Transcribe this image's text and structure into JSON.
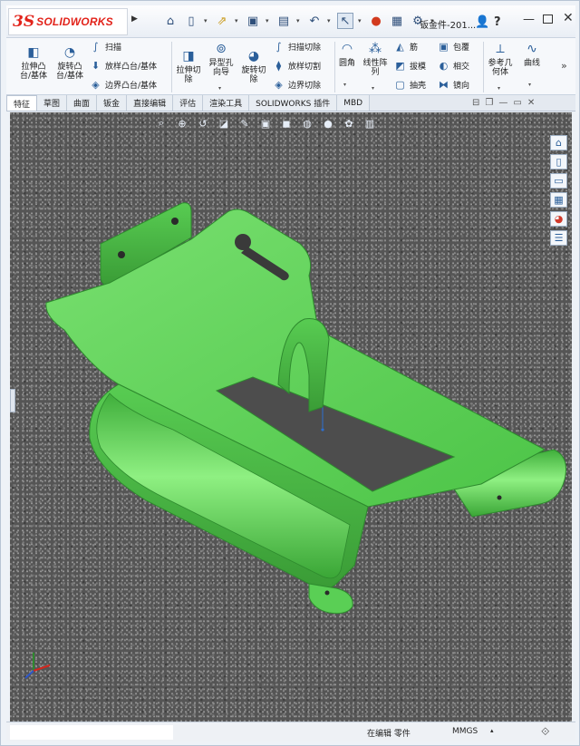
{
  "app": {
    "logo_ds": "3S",
    "logo_name": "SOLIDWORKS",
    "doc_title": "钣金件-201..."
  },
  "quick_access": {
    "icons": [
      "home-icon",
      "new-doc-icon",
      "open-icon",
      "save-icon",
      "print-icon",
      "undo-icon",
      "select-icon",
      "rebuild-icon",
      "file-properties-icon",
      "options-icon"
    ]
  },
  "ribbon": {
    "extrude_boss": "拉伸凸\n台/基体",
    "revolve_boss": "旋转凸\n台/基体",
    "sweep": "扫描",
    "loft_boss": "放样凸台/基体",
    "boundary_boss": "边界凸台/基体",
    "extrude_cut": "拉伸切\n除",
    "hole_wizard": "异型孔\n向导",
    "revolve_cut": "旋转切\n除",
    "sweep_cut": "扫描切除",
    "loft_cut": "放样切割",
    "boundary_cut": "边界切除",
    "fillet": "圆角",
    "linear_pattern": "线性阵\n列",
    "rib": "筋",
    "draft": "拔模",
    "shell": "抽壳",
    "wrap": "包覆",
    "intersect": "相交",
    "mirror": "镜向",
    "reference_geometry": "参考几\n何体",
    "curves": "曲线"
  },
  "tabs": [
    "特征",
    "草图",
    "曲面",
    "钣金",
    "直接编辑",
    "评估",
    "渲染工具",
    "SOLIDWORKS 插件",
    "MBD"
  ],
  "active_tab": "特征",
  "status": {
    "editing": "在编辑 零件",
    "units": "MMGS",
    "units_caret": "▴"
  },
  "colors": {
    "part_green": "#5fd35a",
    "part_edge": "#2e8a2e",
    "logo_red": "#e2231a"
  }
}
